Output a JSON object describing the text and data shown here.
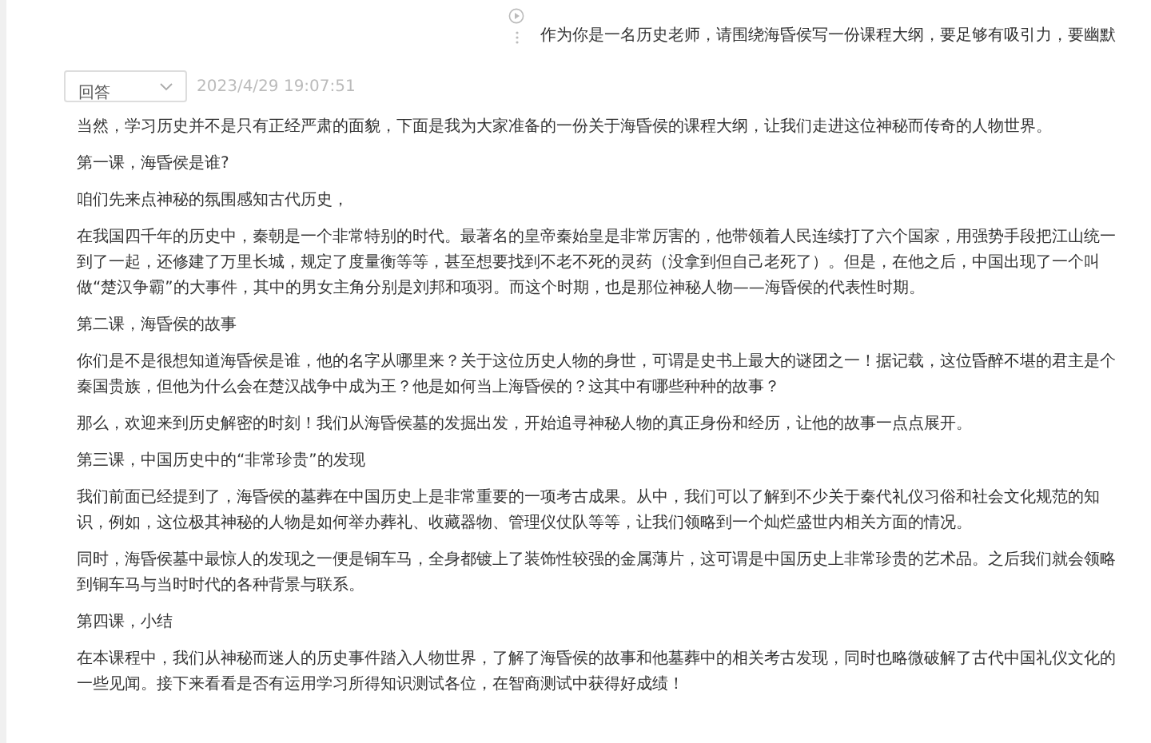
{
  "prompt": {
    "text": "作为你是一名历史老师，请围绕海昏侯写一份课程大纲，要足够有吸引力，要幽默"
  },
  "answer": {
    "mode_select": "回答",
    "timestamp": "2023/4/29 19:07:51",
    "paragraphs": [
      "当然，学习历史并不是只有正经严肃的面貌，下面是我为大家准备的一份关于海昏侯的课程大纲，让我们走进这位神秘而传奇的人物世界。",
      "第一课，海昏侯是谁?",
      "咱们先来点神秘的氛围感知古代历史，",
      "在我国四千年的历史中，秦朝是一个非常特别的时代。最著名的皇帝秦始皇是非常厉害的，他带领着人民连续打了六个国家，用强势手段把江山统一到了一起，还修建了万里长城，规定了度量衡等等，甚至想要找到不老不死的灵药（没拿到但自己老死了）。但是，在他之后，中国出现了一个叫做“楚汉争霸”的大事件，其中的男女主角分别是刘邦和项羽。而这个时期，也是那位神秘人物——海昏侯的代表性时期。",
      "第二课，海昏侯的故事",
      "你们是不是很想知道海昏侯是谁，他的名字从哪里来？关于这位历史人物的身世，可谓是史书上最大的谜团之一！据记载，这位昏醉不堪的君主是个秦国贵族，但他为什么会在楚汉战争中成为王？他是如何当上海昏侯的？这其中有哪些种种的故事？",
      "那么，欢迎来到历史解密的时刻！我们从海昏侯墓的发掘出发，开始追寻神秘人物的真正身份和经历，让他的故事一点点展开。",
      "第三课，中国历史中的“非常珍贵”的发现",
      "我们前面已经提到了，海昏侯的墓葬在中国历史上是非常重要的一项考古成果。从中，我们可以了解到不少关于秦代礼仪习俗和社会文化规范的知识，例如，这位极其神秘的人物是如何举办葬礼、收藏器物、管理仪仗队等等，让我们领略到一个灿烂盛世内相关方面的情况。",
      "同时，海昏侯墓中最惊人的发现之一便是铜车马，全身都镀上了装饰性较强的金属薄片，这可谓是中国历史上非常珍贵的艺术品。之后我们就会领略到铜车马与当时时代的各种背景与联系。",
      "第四课，小结",
      "在本课程中，我们从神秘而迷人的历史事件踏入人物世界，了解了海昏侯的故事和他墓葬中的相关考古发现，同时也略微破解了古代中国礼仪文化的一些见闻。接下来看看是否有运用学习所得知识测试各位，在智商测试中获得好成绩！"
    ]
  }
}
